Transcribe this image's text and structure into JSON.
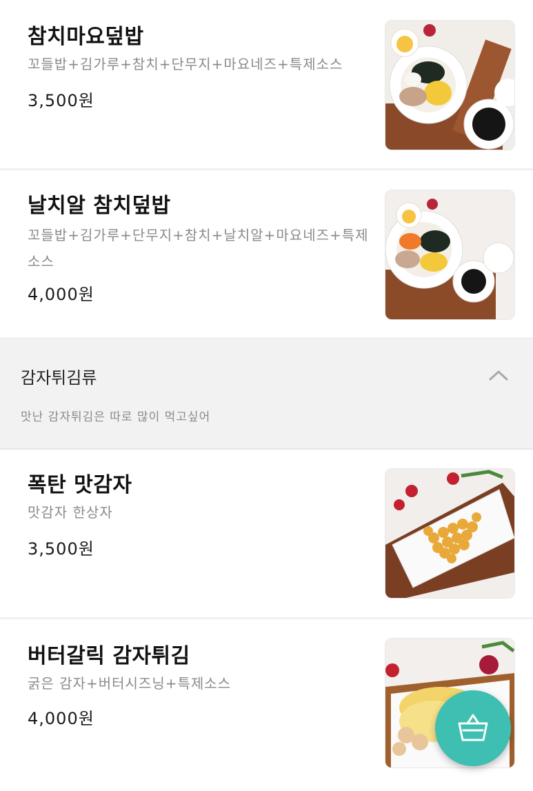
{
  "menu_items": [
    {
      "name": "참치마요덮밥",
      "desc": "꼬들밥+김가루+참치+단무지+마요네즈+특제소스",
      "price": "3,500원"
    },
    {
      "name": "날치알 참치덮밥",
      "desc": "꼬들밥+김가루+단무지+참치+날치알+마요네즈+특제소스",
      "price": "4,000원"
    },
    {
      "name": "폭탄 맛감자",
      "desc": "맛감자 한상자",
      "price": "3,500원"
    },
    {
      "name": "버터갈릭 감자튀김",
      "desc": "굵은 감자+버터시즈닝+특제소스",
      "price": "4,000원"
    }
  ],
  "category": {
    "title": "감자튀김류",
    "description": "맛난 감자튀김은 따로 많이 먹고싶어"
  },
  "icons": {
    "collapse": "chevron-up-icon",
    "cart": "basket-icon"
  },
  "colors": {
    "accent": "#3ebfb1"
  }
}
